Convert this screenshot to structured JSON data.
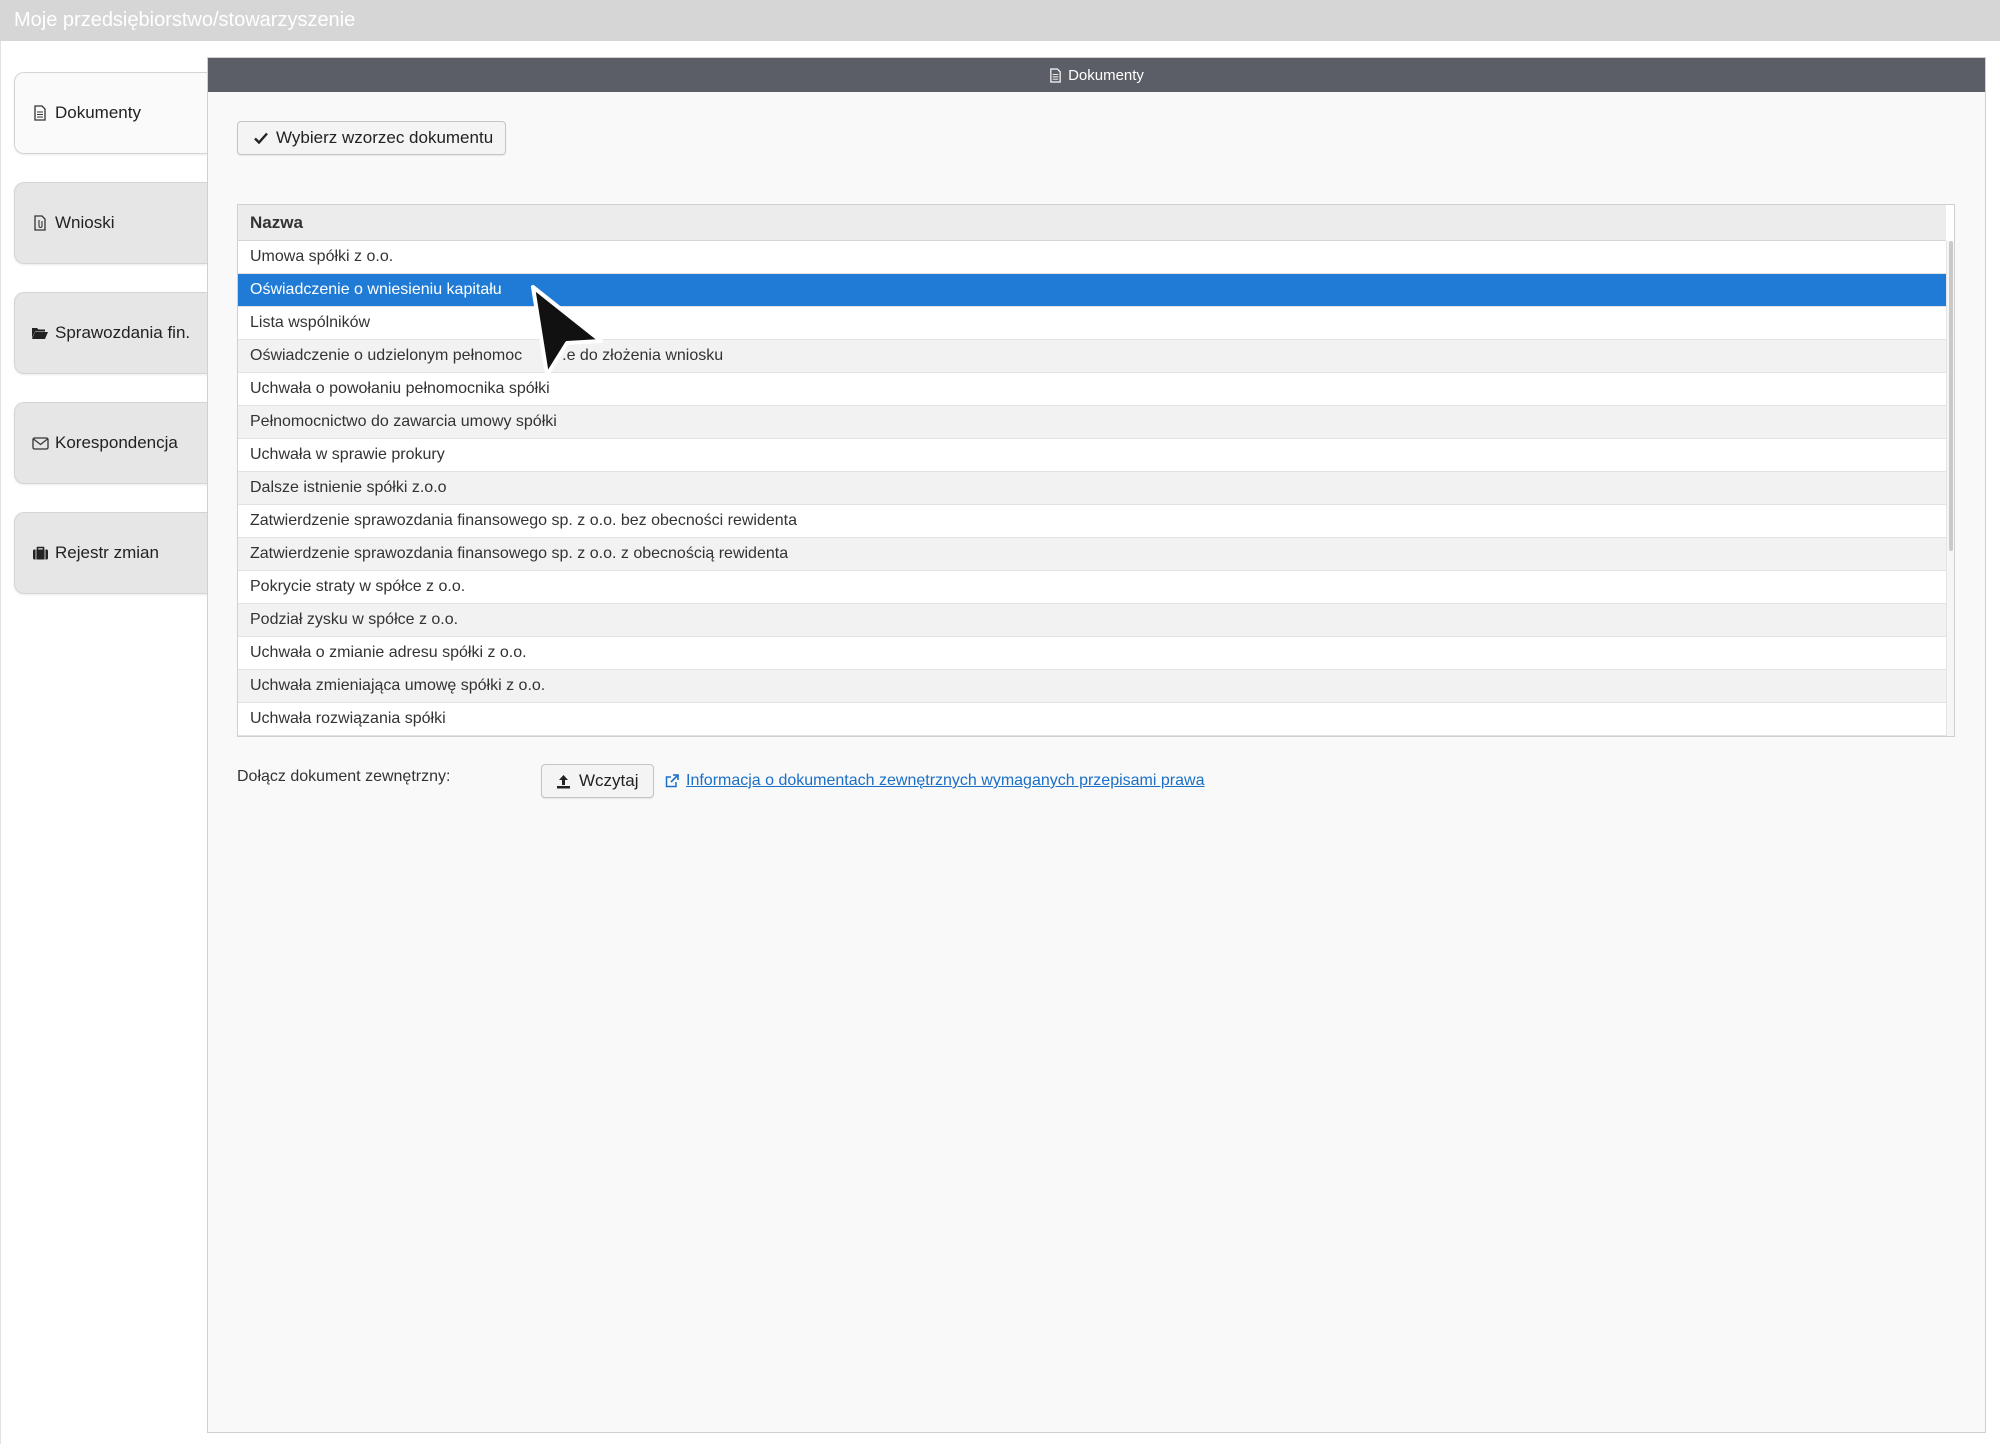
{
  "window": {
    "title": "Moje przedsiębiorstwo/stowarzyszenie"
  },
  "sidebar": {
    "items": [
      {
        "label": "Dokumenty",
        "icon": "document-icon",
        "active": true
      },
      {
        "label": "Wnioski",
        "icon": "file-attachment-icon",
        "active": false
      },
      {
        "label": "Sprawozdania fin.",
        "icon": "folder-open-icon",
        "active": false
      },
      {
        "label": "Korespondencja",
        "icon": "envelope-icon",
        "active": false
      },
      {
        "label": "Rejestr zmian",
        "icon": "briefcase-icon",
        "active": false
      }
    ]
  },
  "panel": {
    "title": "Dokumenty",
    "select_template_button": "Wybierz wzorzec dokumentu",
    "table": {
      "column_header": "Nazwa",
      "selected_index": 1,
      "rows": [
        "Umowa spółki z o.o.",
        "Oświadczenie o wniesieniu kapitału",
        "Lista wspólników",
        "Oświadczenie o udzielonym pełnomoc",
        "Uchwała o powołaniu pełnomocnika spółki",
        "Pełnomocnictwo do zawarcia umowy spółki",
        "Uchwała w sprawie prokury",
        "Dalsze istnienie spółki z.o.o",
        "Zatwierdzenie sprawozdania finansowego sp. z o.o. bez obecności rewidenta",
        "Zatwierdzenie sprawozdania finansowego sp. z o.o. z obecnością rewidenta",
        "Pokrycie straty w spółce z o.o.",
        "Podział zysku w spółce z o.o.",
        "Uchwała o zmianie adresu spółki z o.o.",
        "Uchwała zmieniająca umowę spółki z o.o.",
        "Uchwała rozwiązania spółki"
      ],
      "row3_tail": ".e do złożenia wniosku"
    },
    "attach_label": "Dołącz dokument zewnętrzny:",
    "upload_button": "Wczytaj",
    "info_link": "Informacja o dokumentach zewnętrznych wymaganych przepisami prawa"
  },
  "colors": {
    "header_bg": "#5b5e66",
    "selected_row": "#1f7bd6",
    "link": "#1a6fc7",
    "titlebar": "#d6d6d6"
  }
}
